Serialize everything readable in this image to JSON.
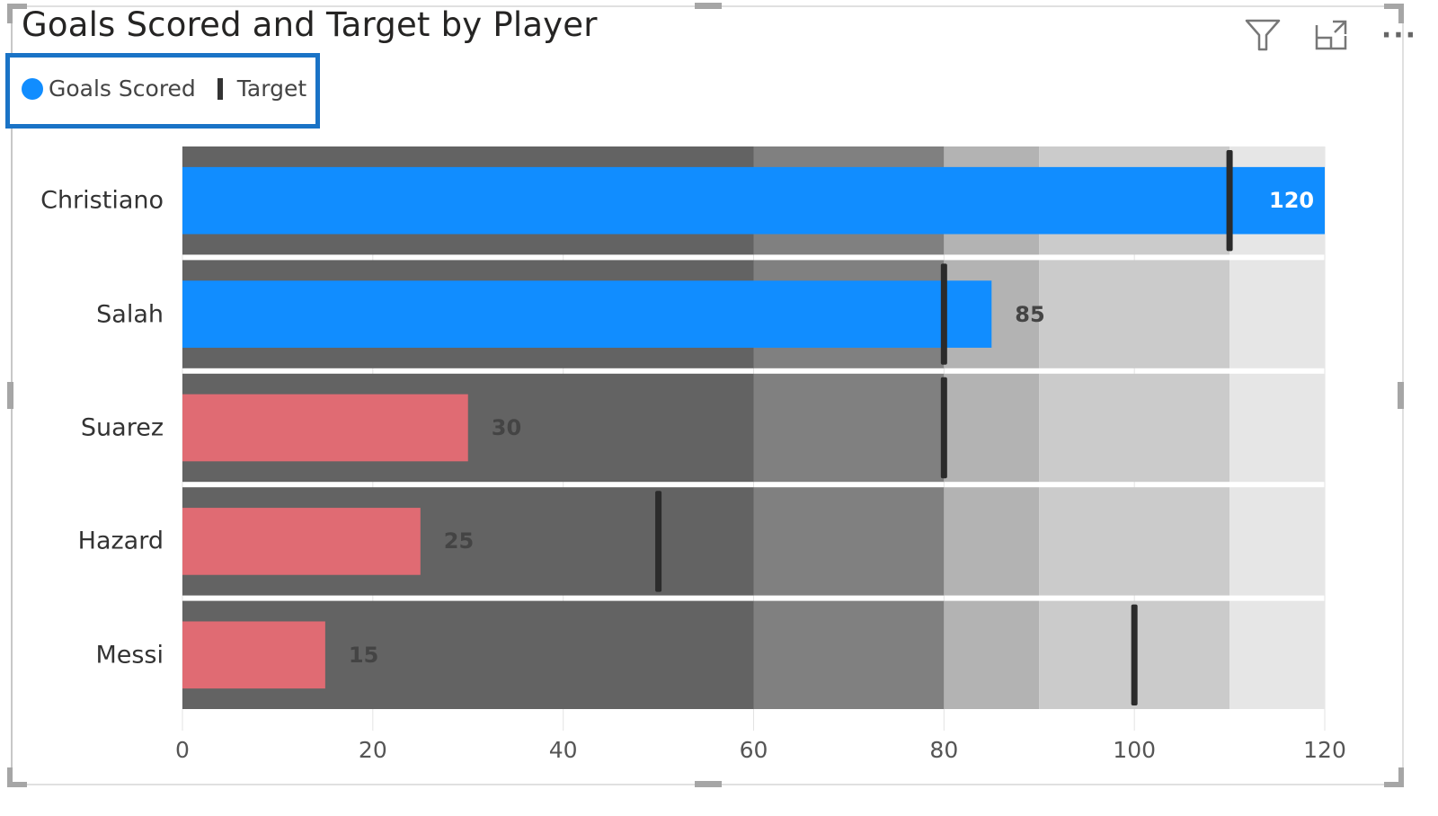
{
  "visual": {
    "title": "Goals Scored and Target by Player",
    "toolbar": {
      "filter_icon": "funnel-icon",
      "focus_icon": "focus-mode-icon",
      "more_icon": "more-options-icon",
      "more_label": "···"
    }
  },
  "legend": {
    "items": [
      {
        "label": "Goals Scored",
        "marker": "circle",
        "color": "#118dff"
      },
      {
        "label": "Target",
        "marker": "bar",
        "color": "#333333"
      }
    ]
  },
  "colors": {
    "above_target": "#118dff",
    "below_target": "#e06b73",
    "target": "#2b2b2b",
    "label_inside": "#ffffff",
    "label_outside": "#444444"
  },
  "chart_data": {
    "type": "bar",
    "subtype": "bullet",
    "orientation": "horizontal",
    "title": "Goals Scored and Target by Player",
    "categories": [
      "Christiano",
      "Salah",
      "Suarez",
      "Hazard",
      "Messi"
    ],
    "series": [
      {
        "name": "Goals Scored",
        "values": [
          120,
          85,
          30,
          25,
          15
        ]
      },
      {
        "name": "Target",
        "values": [
          110,
          80,
          80,
          50,
          100
        ]
      }
    ],
    "bands": [
      {
        "from": 0,
        "to": 60,
        "color": "#636363"
      },
      {
        "from": 60,
        "to": 80,
        "color": "#808080"
      },
      {
        "from": 80,
        "to": 90,
        "color": "#b3b3b3"
      },
      {
        "from": 90,
        "to": 110,
        "color": "#cbcbcb"
      },
      {
        "from": 110,
        "to": 120,
        "color": "#e6e6e6"
      }
    ],
    "xticks": [
      0,
      20,
      40,
      60,
      80,
      100,
      120
    ],
    "xlim": [
      0,
      120
    ],
    "xlabel": "",
    "ylabel": "",
    "legend_position": "top-left",
    "grid": true
  }
}
